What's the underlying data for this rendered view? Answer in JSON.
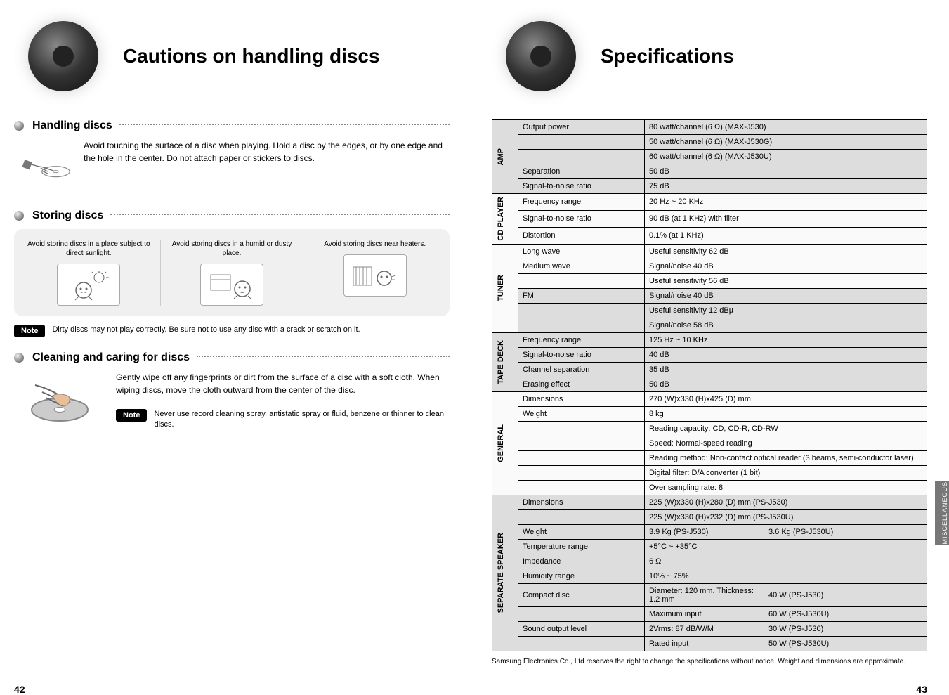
{
  "left": {
    "pageNum": "42",
    "headerTitle": "Cautions on handling discs",
    "section1": {
      "title": "Handling discs",
      "text": "Avoid touching the surface of a disc when playing. Hold a disc by the edges, or by one edge and the hole in the center. Do not attach paper or stickers to discs."
    },
    "section2": {
      "title": "Storing discs",
      "col1": "Avoid storing discs in a place subject to direct sunlight.",
      "col2": "Avoid storing discs in a humid or dusty place.",
      "col3": "Avoid storing discs near heaters.",
      "noteLabel": "Note",
      "noteText": "Dirty discs may not play correctly. Be sure not to use any disc with a crack or scratch on it."
    },
    "section3": {
      "title": "Cleaning and caring for discs",
      "text": "Gently wipe off any fingerprints or dirt from the surface of a disc with a soft cloth. When wiping discs, move the cloth outward from the center of the disc.",
      "noteLabel": "Note",
      "noteText": "Never use record cleaning spray, antistatic spray or fluid, benzene or thinner to clean discs."
    }
  },
  "right": {
    "pageNum": "43",
    "headerTitle": "Specifications",
    "sideTab": "MISCELLANEOUS",
    "groups": {
      "amp": "AMP",
      "cd": "CD PLAYER",
      "tuner": "TUNER",
      "tape": "TAPE DECK",
      "general": "GENERAL",
      "separate": "SEPARATE SPEAKER"
    },
    "rows": [
      {
        "g": "amp",
        "shade": "dark",
        "label": "Output power",
        "value": "80 watt/channel (6 Ω) (MAX-J530)"
      },
      {
        "g": "amp",
        "shade": "dark",
        "label": "",
        "value": "50 watt/channel (6 Ω) (MAX-J530G)"
      },
      {
        "g": "amp",
        "shade": "dark",
        "label": "",
        "value": "60 watt/channel (6 Ω) (MAX-J530U)"
      },
      {
        "g": "amp",
        "shade": "dark",
        "label": "Separation",
        "value": "50 dB"
      },
      {
        "g": "amp",
        "shade": "dark",
        "label": "Signal-to-noise ratio",
        "value": "75 dB"
      },
      {
        "g": "cd",
        "shade": "light",
        "label": "Frequency range",
        "value": "20 Hz ~ 20 KHz"
      },
      {
        "g": "cd",
        "shade": "light",
        "label": "Signal-to-noise ratio",
        "value": "90 dB (at 1 KHz) with filter"
      },
      {
        "g": "cd",
        "shade": "light",
        "label": "Distortion",
        "value": "0.1% (at 1 KHz)"
      },
      {
        "g": "tuner",
        "shade": "light",
        "label": "Long wave",
        "value": "Useful sensitivity 62 dB"
      },
      {
        "g": "tuner",
        "shade": "light",
        "label": "Medium wave",
        "value": "Signal/noise 40 dB"
      },
      {
        "g": "tuner",
        "shade": "light",
        "label": "",
        "value": "Useful sensitivity 56 dB"
      },
      {
        "g": "tuner",
        "shade": "dark",
        "label": "FM",
        "value": "Signal/noise 40 dB"
      },
      {
        "g": "tuner",
        "shade": "dark",
        "label": "",
        "value": "Useful sensitivity 12 dBµ"
      },
      {
        "g": "tuner",
        "shade": "dark",
        "label": "",
        "value": "Signal/noise 58 dB"
      },
      {
        "g": "tape",
        "shade": "dark",
        "label": "Frequency range",
        "value": "125 Hz ~ 10 KHz"
      },
      {
        "g": "tape",
        "shade": "dark",
        "label": "Signal-to-noise ratio",
        "value": "40 dB"
      },
      {
        "g": "tape",
        "shade": "dark",
        "label": "Channel separation",
        "value": "35 dB"
      },
      {
        "g": "tape",
        "shade": "dark",
        "label": "Erasing effect",
        "value": "50 dB"
      },
      {
        "g": "general",
        "shade": "light",
        "label": "Dimensions",
        "value": "270 (W)x330 (H)x425 (D) mm"
      },
      {
        "g": "general",
        "shade": "light",
        "label": "Weight",
        "value": "8 kg"
      },
      {
        "g": "general",
        "shade": "light",
        "label": "",
        "value": "Reading capacity: CD, CD-R, CD-RW"
      },
      {
        "g": "general",
        "shade": "light",
        "label": "",
        "value": "Speed: Normal-speed reading"
      },
      {
        "g": "general",
        "shade": "light",
        "label": "",
        "value": "Reading method: Non-contact optical reader (3 beams, semi-conductor laser)"
      },
      {
        "g": "general",
        "shade": "light",
        "label": "",
        "value": "Digital filter: D/A converter (1 bit)"
      },
      {
        "g": "general",
        "shade": "light",
        "label": "",
        "value": "Over sampling rate: 8"
      }
    ],
    "speaker": {
      "rows": [
        {
          "label": "Dimensions",
          "v1": "225 (W)x330 (H)x280 (D) mm (PS-J530)",
          "v2": ""
        },
        {
          "label": "",
          "v1": "225 (W)x330 (H)x232 (D) mm (PS-J530U)",
          "v2": ""
        },
        {
          "label": "Weight",
          "v1": "3.9 Kg (PS-J530)",
          "v2": "3.6 Kg (PS-J530U)"
        },
        {
          "label": "Temperature range",
          "v1": "+5°C ~ +35°C",
          "v2": ""
        },
        {
          "label": "Impedance",
          "v1": "6 Ω",
          "v2": ""
        },
        {
          "label": "Humidity range",
          "v1": "10% ~ 75%",
          "v2": ""
        },
        {
          "label": "Compact disc",
          "v1": "Diameter: 120 mm. Thickness: 1.2 mm",
          "v2": "40 W (PS-J530)"
        },
        {
          "label": "",
          "v1": "Maximum input",
          "v2": "60 W (PS-J530U)"
        },
        {
          "label": "Sound output level",
          "v1": "2Vrms: 87 dB/W/M",
          "v2": "30 W (PS-J530)"
        },
        {
          "label": "",
          "v1": "Rated input",
          "v2": "50 W (PS-J530U)"
        }
      ]
    },
    "footer": "Samsung Electronics Co., Ltd reserves the right to change the specifications without notice.\nWeight and dimensions are approximate."
  }
}
